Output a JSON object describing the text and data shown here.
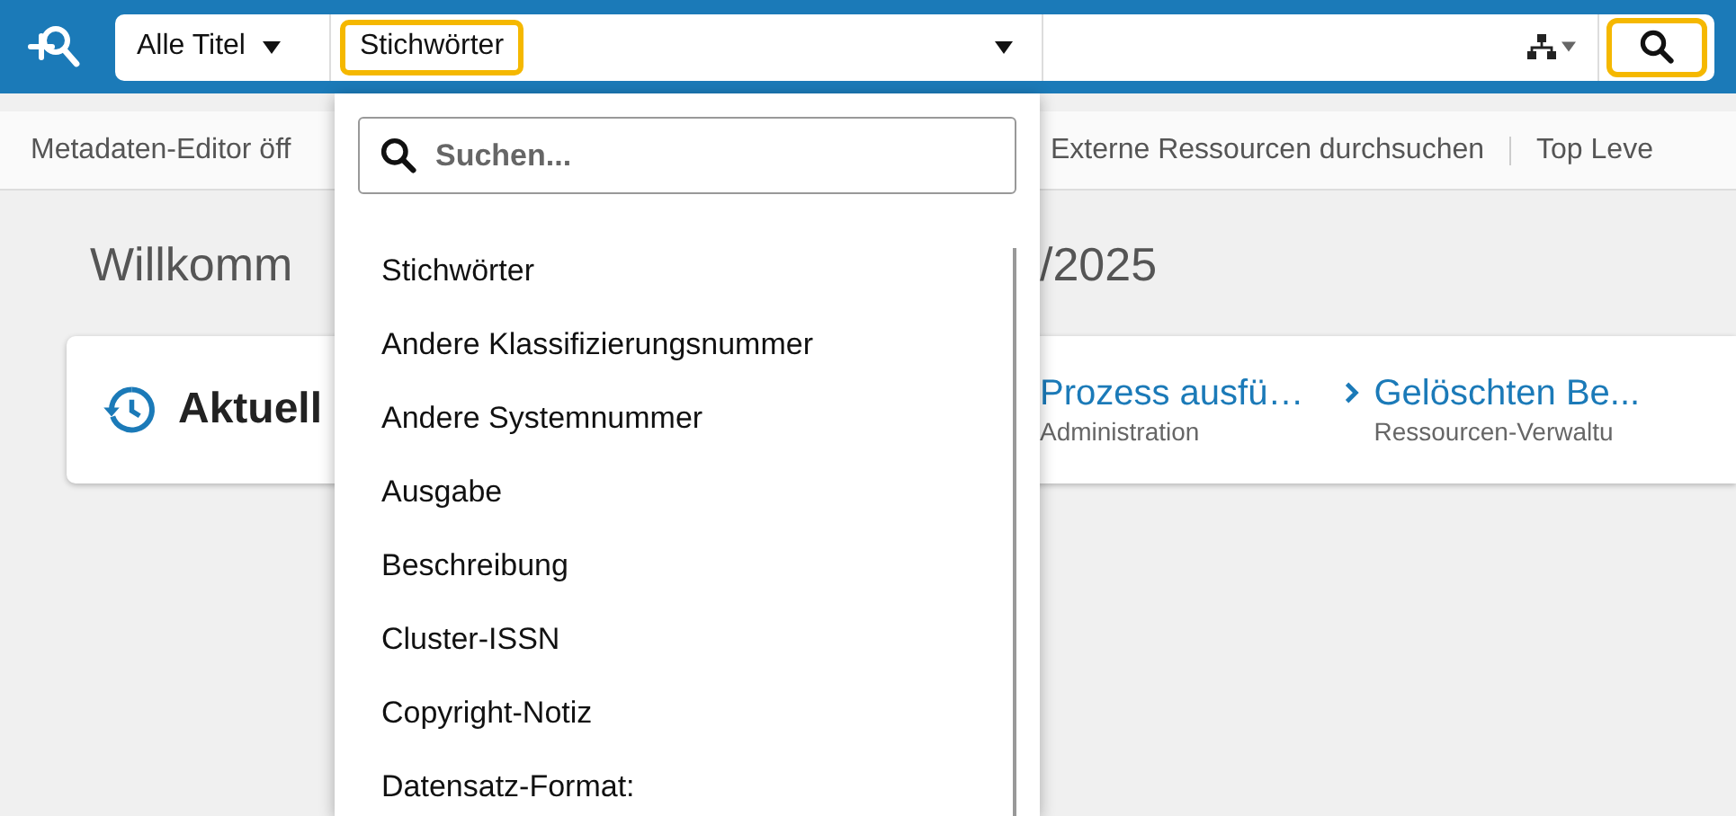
{
  "search_bar": {
    "scope": "Alle Titel",
    "field": "Stichwörter",
    "field_focused": true,
    "search_button_focused": true
  },
  "nav_links": [
    "Metadaten-Editor öff",
    "Externe Ressourcen durchsuchen",
    "Top Leve"
  ],
  "welcome": {
    "title_start": "Willkomm",
    "title_end": "/2025"
  },
  "recent_card": {
    "title": "Aktuell",
    "items": [
      {
        "title": "Prozess ausfü…",
        "subtitle": "Administration",
        "chevron": false
      },
      {
        "title": "Gelöschten Be...",
        "subtitle": "Ressourcen-Verwaltu",
        "chevron": true
      }
    ]
  },
  "field_dropdown": {
    "search_placeholder": "Suchen...",
    "options": [
      {
        "label": "Stichwörter",
        "selected": false
      },
      {
        "label": "Andere Klassifizierungsnummer",
        "selected": false
      },
      {
        "label": "Andere Systemnummer",
        "selected": false
      },
      {
        "label": "Ausgabe",
        "selected": false
      },
      {
        "label": "Beschreibung",
        "selected": false
      },
      {
        "label": "Cluster-ISSN",
        "selected": false
      },
      {
        "label": "Copyright-Notiz",
        "selected": false
      },
      {
        "label": "Datensatz-Format:",
        "selected": false
      }
    ]
  }
}
